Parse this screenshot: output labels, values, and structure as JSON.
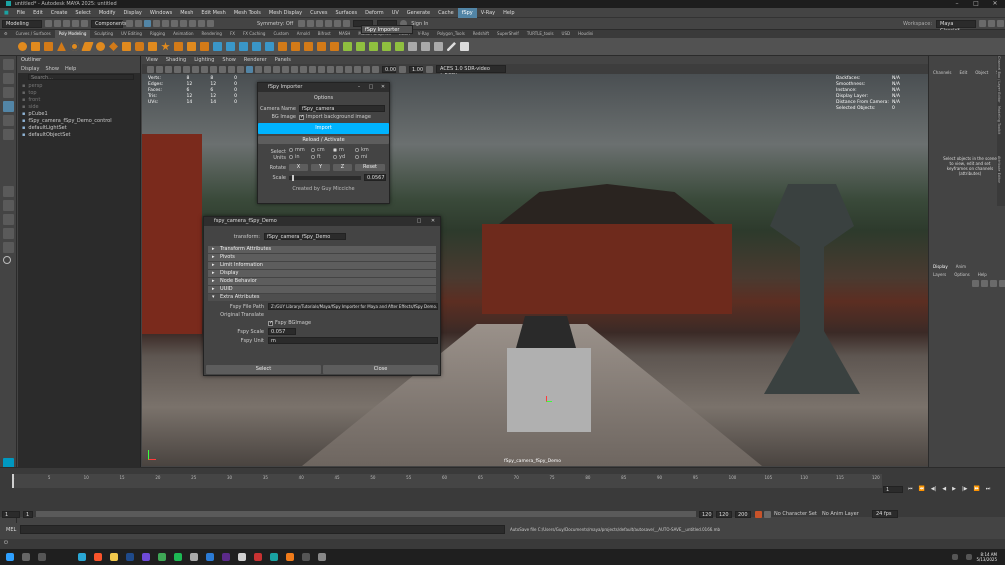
{
  "window": {
    "title": "untitled* - Autodesk MAYA 2025: untitled",
    "min": "–",
    "max": "□",
    "close": "✕"
  },
  "menubar": [
    "File",
    "Edit",
    "Create",
    "Select",
    "Modify",
    "Display",
    "Windows",
    "Mesh",
    "Edit Mesh",
    "Mesh Tools",
    "Mesh Display",
    "Curves",
    "Surfaces",
    "Deform",
    "UV",
    "Generate",
    "Cache",
    "fSpy",
    "V-Ray",
    "Help"
  ],
  "menubar_selected": "fSpy",
  "fspy_popup": {
    "item": "fSpy Importer"
  },
  "statusline": {
    "mode": "Modeling",
    "components_label": "Components",
    "symmetry": "Symmetry: Off",
    "signin": "Sign In",
    "workspace_label": "Workspace:",
    "workspace": "Maya Classic*"
  },
  "shelf_tabs": [
    "Curves / Surfaces",
    "Poly Modeling",
    "Sculpting",
    "UV Editing",
    "Rigging",
    "Animation",
    "Rendering",
    "FX",
    "FX Caching",
    "Custom",
    "Arnold",
    "Bifrost",
    "MASH",
    "Motion Graphics",
    "XGen",
    "V-Ray",
    "Polygon_Tools",
    "Redshift",
    "SuperShelf",
    "TURTLE_tools",
    "USD",
    "Houdini"
  ],
  "shelf_active": "Poly Modeling",
  "outliner": {
    "title": "Outliner",
    "menu": [
      "Display",
      "Show",
      "Help"
    ],
    "search_placeholder": "Search...",
    "items": [
      {
        "label": "persp",
        "dim": true
      },
      {
        "label": "top",
        "dim": true
      },
      {
        "label": "front",
        "dim": true
      },
      {
        "label": "side",
        "dim": true
      },
      {
        "label": "pCube1",
        "dim": false
      },
      {
        "label": "fSpy_camera_fSpy_Demo_control",
        "dim": false
      },
      {
        "label": "defaultLightSet",
        "dim": false
      },
      {
        "label": "defaultObjectSet",
        "dim": false
      }
    ]
  },
  "viewport": {
    "menu": [
      "View",
      "Shading",
      "Lighting",
      "Show",
      "Renderer",
      "Panels"
    ],
    "hud_left": [
      {
        "label": "Verts:",
        "v1": "8",
        "v2": "8",
        "v3": "0"
      },
      {
        "label": "Edges:",
        "v1": "12",
        "v2": "12",
        "v3": "0"
      },
      {
        "label": "Faces:",
        "v1": "6",
        "v2": "6",
        "v3": "0"
      },
      {
        "label": "Tris:",
        "v1": "12",
        "v2": "12",
        "v3": "0"
      },
      {
        "label": "UVs:",
        "v1": "14",
        "v2": "14",
        "v3": "0"
      }
    ],
    "hud_right": [
      {
        "label": "Backfaces:",
        "value": "N/A"
      },
      {
        "label": "Smoothness:",
        "value": "N/A"
      },
      {
        "label": "Instance:",
        "value": "N/A"
      },
      {
        "label": "Display Layer:",
        "value": "N/A"
      },
      {
        "label": "Distance From Camera:",
        "value": "N/A"
      },
      {
        "label": "Selected Objects:",
        "value": "0"
      }
    ],
    "camera_label": "fSpy_camera_fSpy_Demo",
    "exposure": "0.00",
    "gamma": "1.00",
    "colorspace": "ACES 1.0 SDR-video (sRGB)"
  },
  "fspy_importer": {
    "title": "fSpy Importer",
    "options_header": "Options",
    "camera_name_label": "Camera Name",
    "camera_name_value": "fSpy_camera",
    "bg_label": "BG Image",
    "bg_checkbox_label": "Import background image",
    "import_button": "Import",
    "reload_header": "Reload / Activate",
    "select_units_label": "Select Units",
    "units": [
      "mm",
      "cm",
      "m",
      "km",
      "in",
      "ft",
      "yd",
      "mi"
    ],
    "units_selected": "m",
    "rotate_label": "Rotate",
    "rotate_x": "X",
    "rotate_y": "Y",
    "rotate_z": "Z",
    "reset_button": "Reset",
    "scale_label": "Scale",
    "scale_value": "0.0567",
    "footer": "Created by Guy Micciche"
  },
  "attr_editor": {
    "title": "fspy_camera_fSpy_Demo",
    "transform_label": "transform:",
    "transform_value": "fSpy_camera_fSpy_Demo",
    "sections": [
      "Transform Attributes",
      "Pivots",
      "Limit Information",
      "Display",
      "Node Behavior",
      "UUID"
    ],
    "extra_header": "Extra Attributes",
    "file_path_label": "Fspy File Path",
    "file_path_value": "Z:/GUY Library/Tutorials/Maya/fSpy Importer for Maya and After Effects/fSpy Demo.fspy",
    "orig_translate_label": "Original Translate",
    "bg_image_label": "Fspy BGImage",
    "scale_label": "Fspy Scale",
    "scale_value": "0.057",
    "unit_label": "Fspy Unit",
    "unit_value": "m",
    "select_button": "Select",
    "close_button": "Close"
  },
  "channel_box": {
    "tabs": [
      "Channels",
      "Edit",
      "Object",
      "Show"
    ],
    "hint": "Select objects in the scene to view, edit and set keyframes on channels (attributes)",
    "layer_tabs": [
      "Display",
      "Anim"
    ],
    "layer_menu": [
      "Layers",
      "Options",
      "Help"
    ],
    "side_tabs": [
      "Channel Box / Layer Editor",
      "Modeling Toolkit",
      "Attribute Editor"
    ]
  },
  "timeline": {
    "ticks": [
      "1",
      "5",
      "10",
      "15",
      "20",
      "25",
      "30",
      "35",
      "40",
      "45",
      "50",
      "55",
      "60",
      "65",
      "70",
      "75",
      "80",
      "85",
      "90",
      "95",
      "100",
      "105",
      "110",
      "115",
      "120"
    ],
    "current_frame": "1",
    "range_start": "1",
    "range_start2": "1",
    "range_end": "120",
    "range_end2": "120",
    "range_end3": "200",
    "character_set": "No Character Set",
    "anim_layer": "No Anim Layer",
    "fps": "24 fps"
  },
  "status": {
    "mel_label": "MEL",
    "message": "AutoSave file C:/Users/Guy/Documents/maya/projects/default/autosave/__AUTO-SAVE__untitled.0166.mb"
  },
  "taskbar": {
    "time": "8:14 AM",
    "date": "5/13/2025"
  },
  "colors": {
    "accent": "#5285a6",
    "import_button": "#00b4ff",
    "dialog_bg": "#444444"
  }
}
